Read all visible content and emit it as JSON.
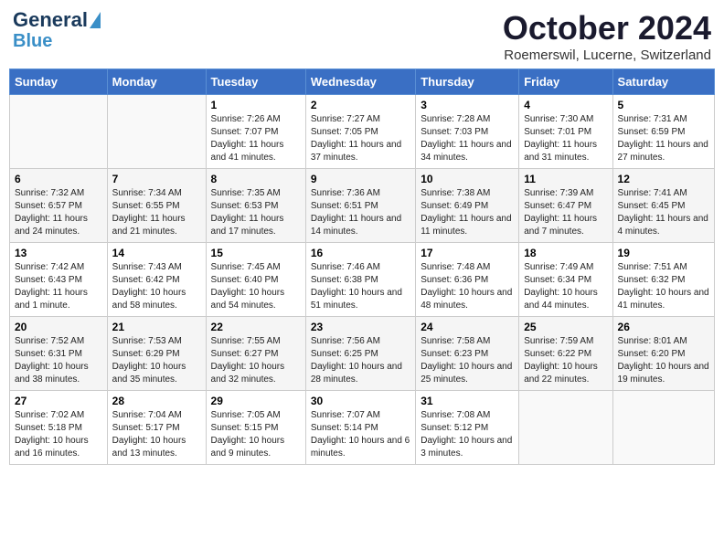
{
  "header": {
    "logo_line1": "General",
    "logo_line2": "Blue",
    "month": "October 2024",
    "location": "Roemerswil, Lucerne, Switzerland"
  },
  "weekdays": [
    "Sunday",
    "Monday",
    "Tuesday",
    "Wednesday",
    "Thursday",
    "Friday",
    "Saturday"
  ],
  "weeks": [
    [
      {
        "day": "",
        "info": ""
      },
      {
        "day": "",
        "info": ""
      },
      {
        "day": "1",
        "info": "Sunrise: 7:26 AM\nSunset: 7:07 PM\nDaylight: 11 hours and 41 minutes."
      },
      {
        "day": "2",
        "info": "Sunrise: 7:27 AM\nSunset: 7:05 PM\nDaylight: 11 hours and 37 minutes."
      },
      {
        "day": "3",
        "info": "Sunrise: 7:28 AM\nSunset: 7:03 PM\nDaylight: 11 hours and 34 minutes."
      },
      {
        "day": "4",
        "info": "Sunrise: 7:30 AM\nSunset: 7:01 PM\nDaylight: 11 hours and 31 minutes."
      },
      {
        "day": "5",
        "info": "Sunrise: 7:31 AM\nSunset: 6:59 PM\nDaylight: 11 hours and 27 minutes."
      }
    ],
    [
      {
        "day": "6",
        "info": "Sunrise: 7:32 AM\nSunset: 6:57 PM\nDaylight: 11 hours and 24 minutes."
      },
      {
        "day": "7",
        "info": "Sunrise: 7:34 AM\nSunset: 6:55 PM\nDaylight: 11 hours and 21 minutes."
      },
      {
        "day": "8",
        "info": "Sunrise: 7:35 AM\nSunset: 6:53 PM\nDaylight: 11 hours and 17 minutes."
      },
      {
        "day": "9",
        "info": "Sunrise: 7:36 AM\nSunset: 6:51 PM\nDaylight: 11 hours and 14 minutes."
      },
      {
        "day": "10",
        "info": "Sunrise: 7:38 AM\nSunset: 6:49 PM\nDaylight: 11 hours and 11 minutes."
      },
      {
        "day": "11",
        "info": "Sunrise: 7:39 AM\nSunset: 6:47 PM\nDaylight: 11 hours and 7 minutes."
      },
      {
        "day": "12",
        "info": "Sunrise: 7:41 AM\nSunset: 6:45 PM\nDaylight: 11 hours and 4 minutes."
      }
    ],
    [
      {
        "day": "13",
        "info": "Sunrise: 7:42 AM\nSunset: 6:43 PM\nDaylight: 11 hours and 1 minute."
      },
      {
        "day": "14",
        "info": "Sunrise: 7:43 AM\nSunset: 6:42 PM\nDaylight: 10 hours and 58 minutes."
      },
      {
        "day": "15",
        "info": "Sunrise: 7:45 AM\nSunset: 6:40 PM\nDaylight: 10 hours and 54 minutes."
      },
      {
        "day": "16",
        "info": "Sunrise: 7:46 AM\nSunset: 6:38 PM\nDaylight: 10 hours and 51 minutes."
      },
      {
        "day": "17",
        "info": "Sunrise: 7:48 AM\nSunset: 6:36 PM\nDaylight: 10 hours and 48 minutes."
      },
      {
        "day": "18",
        "info": "Sunrise: 7:49 AM\nSunset: 6:34 PM\nDaylight: 10 hours and 44 minutes."
      },
      {
        "day": "19",
        "info": "Sunrise: 7:51 AM\nSunset: 6:32 PM\nDaylight: 10 hours and 41 minutes."
      }
    ],
    [
      {
        "day": "20",
        "info": "Sunrise: 7:52 AM\nSunset: 6:31 PM\nDaylight: 10 hours and 38 minutes."
      },
      {
        "day": "21",
        "info": "Sunrise: 7:53 AM\nSunset: 6:29 PM\nDaylight: 10 hours and 35 minutes."
      },
      {
        "day": "22",
        "info": "Sunrise: 7:55 AM\nSunset: 6:27 PM\nDaylight: 10 hours and 32 minutes."
      },
      {
        "day": "23",
        "info": "Sunrise: 7:56 AM\nSunset: 6:25 PM\nDaylight: 10 hours and 28 minutes."
      },
      {
        "day": "24",
        "info": "Sunrise: 7:58 AM\nSunset: 6:23 PM\nDaylight: 10 hours and 25 minutes."
      },
      {
        "day": "25",
        "info": "Sunrise: 7:59 AM\nSunset: 6:22 PM\nDaylight: 10 hours and 22 minutes."
      },
      {
        "day": "26",
        "info": "Sunrise: 8:01 AM\nSunset: 6:20 PM\nDaylight: 10 hours and 19 minutes."
      }
    ],
    [
      {
        "day": "27",
        "info": "Sunrise: 7:02 AM\nSunset: 5:18 PM\nDaylight: 10 hours and 16 minutes."
      },
      {
        "day": "28",
        "info": "Sunrise: 7:04 AM\nSunset: 5:17 PM\nDaylight: 10 hours and 13 minutes."
      },
      {
        "day": "29",
        "info": "Sunrise: 7:05 AM\nSunset: 5:15 PM\nDaylight: 10 hours and 9 minutes."
      },
      {
        "day": "30",
        "info": "Sunrise: 7:07 AM\nSunset: 5:14 PM\nDaylight: 10 hours and 6 minutes."
      },
      {
        "day": "31",
        "info": "Sunrise: 7:08 AM\nSunset: 5:12 PM\nDaylight: 10 hours and 3 minutes."
      },
      {
        "day": "",
        "info": ""
      },
      {
        "day": "",
        "info": ""
      }
    ]
  ]
}
